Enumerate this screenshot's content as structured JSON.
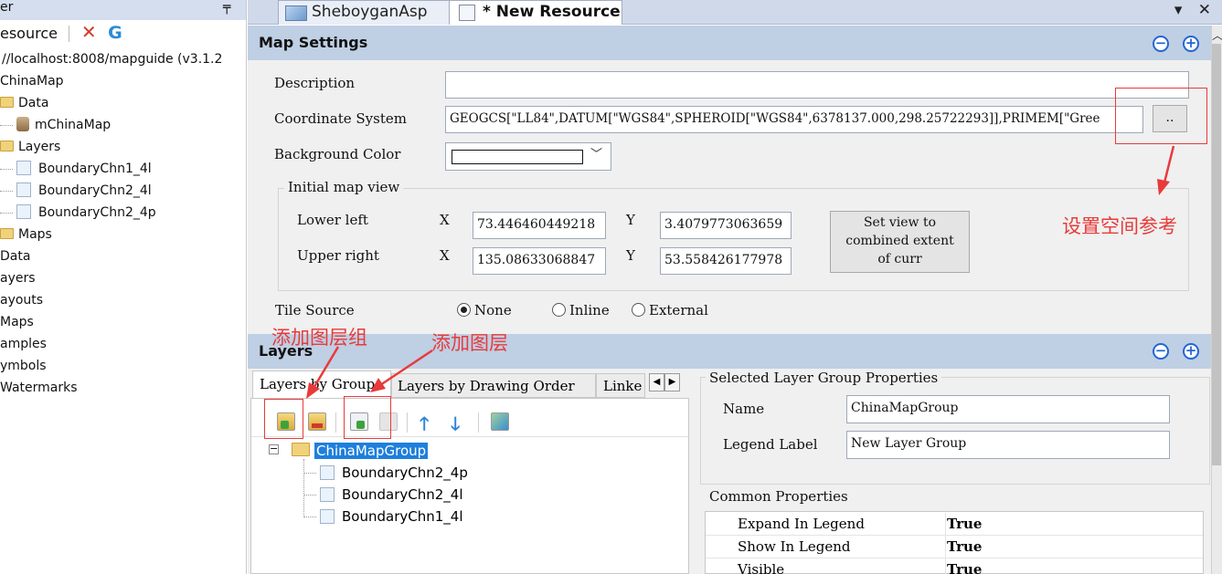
{
  "left_tree": {
    "header": "er",
    "toolbar_label": "esource",
    "server": "//localhost:8008/mapguide (v3.1.2",
    "items": [
      {
        "label": "ChinaMap"
      },
      {
        "label": "Data"
      },
      {
        "label": "mChinaMap"
      },
      {
        "label": "Layers"
      },
      {
        "label": "BoundaryChn1_4l"
      },
      {
        "label": "BoundaryChn2_4l"
      },
      {
        "label": "BoundaryChn2_4p"
      },
      {
        "label": "Maps"
      },
      {
        "label": "Data"
      },
      {
        "label": "ayers"
      },
      {
        "label": "ayouts"
      },
      {
        "label": "Maps"
      },
      {
        "label": "amples"
      },
      {
        "label": "ymbols"
      },
      {
        "label": "Watermarks"
      }
    ]
  },
  "tabs": [
    {
      "label": "SheboyganAsp"
    },
    {
      "label": "* New Resource"
    }
  ],
  "tab_controls": "▾ ✕",
  "map_settings": {
    "title": "Map Settings",
    "description_label": "Description",
    "description_value": "",
    "coord_label": "Coordinate System",
    "coord_value": "GEOGCS[\"LL84\",DATUM[\"WGS84\",SPHEROID[\"WGS84\",6378137.000,298.25722293]],PRIMEM[\"Gree",
    "coord_button": "..",
    "bg_label": "Background Color",
    "bg_value": "#FFFFFF",
    "initial_view_label": "Initial map view",
    "lower_left_label": "Lower left",
    "upper_right_label": "Upper right",
    "x_label": "X",
    "y_label": "Y",
    "lower_left_x": "73.446460449218",
    "lower_left_y": "3.4079773063659",
    "upper_right_x": "135.08633068847",
    "upper_right_y": "53.558426177978",
    "set_view_button": "Set view to combined extent of curr",
    "tile_source_label": "Tile Source",
    "tile_options": [
      {
        "label": "None",
        "selected": true
      },
      {
        "label": "Inline",
        "selected": false
      },
      {
        "label": "External",
        "selected": false
      }
    ]
  },
  "layers": {
    "title": "Layers",
    "tabs": [
      {
        "label": "Layers by Group"
      },
      {
        "label": "Layers by Drawing Order"
      },
      {
        "label": "Linke"
      }
    ],
    "group": "ChinaMapGroup",
    "children": [
      {
        "label": "BoundaryChn2_4p"
      },
      {
        "label": "BoundaryChn2_4l"
      },
      {
        "label": "BoundaryChn1_4l"
      }
    ]
  },
  "group_props": {
    "title": "Selected Layer Group Properties",
    "name_label": "Name",
    "name_value": "ChinaMapGroup",
    "legend_label": "Legend Label",
    "legend_value": "New Layer Group"
  },
  "common_props": {
    "title": "Common Properties",
    "rows": [
      {
        "label": "Expand In Legend",
        "value": "True"
      },
      {
        "label": "Show In Legend",
        "value": "True"
      },
      {
        "label": "Visible",
        "value": "True"
      }
    ]
  },
  "annotations": {
    "set_crs": "设置空间参考",
    "add_group": "添加图层组",
    "add_layer": "添加图层"
  },
  "colors": {
    "accent": "#2466d3",
    "annotation": "#e83a3a",
    "header": "#bfcfe4",
    "selection": "#1e7fdc"
  }
}
